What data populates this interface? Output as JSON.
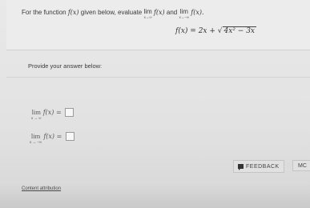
{
  "question": {
    "prefix": "For the function ",
    "func": "f(x)",
    "middle": " given below, evaluate ",
    "lim1_word": "lim",
    "lim1_sub": "x→∞",
    "lim1_expr": "f(x)",
    "and_text": " and ",
    "lim2_word": "lim",
    "lim2_sub": "x→−∞",
    "lim2_expr": "f(x).",
    "equation_lhs": "f(x) = 2x + ",
    "equation_radicand": "4x² − 3x"
  },
  "provide_label": "Provide your answer below:",
  "answers": [
    {
      "lim_word": "lim",
      "lim_sub": "x → ∞",
      "expr": "f(x) ="
    },
    {
      "lim_word": "lim",
      "lim_sub": "x → −∞",
      "expr": "f(x) ="
    }
  ],
  "content_attribution": "Content attribution",
  "feedback_label": "FEEDBACK",
  "more_label": "MC"
}
